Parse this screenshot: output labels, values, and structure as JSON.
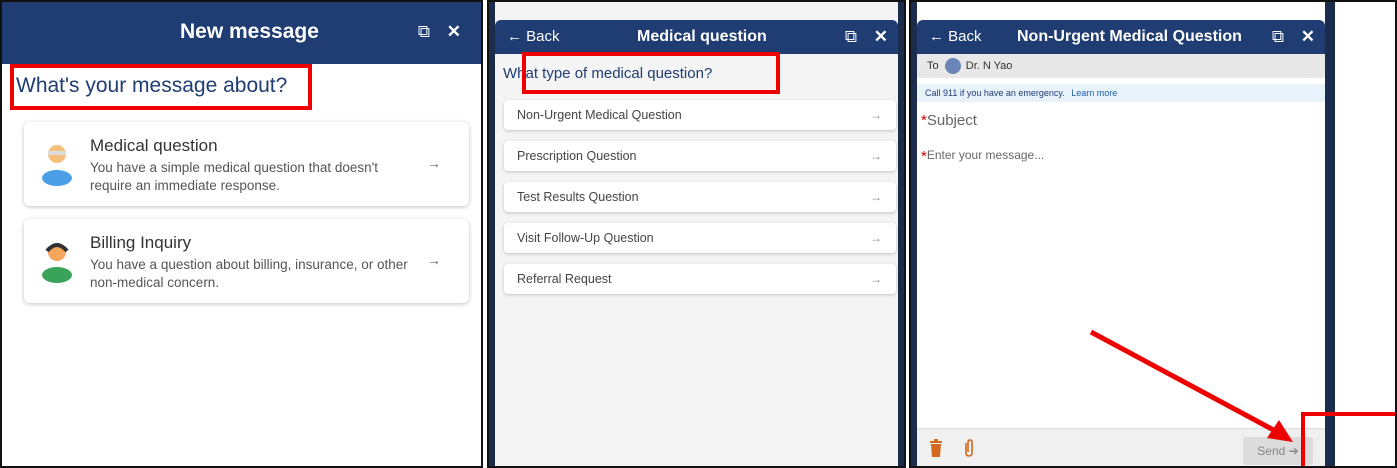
{
  "panel1": {
    "title": "New message",
    "question": "What's your message about?",
    "cards": [
      {
        "title": "Medical question",
        "desc": "You have a simple medical question that doesn't require an immediate response.",
        "arrow": "→"
      },
      {
        "title": "Billing Inquiry",
        "desc": "You have a question about billing, insurance, or other non-medical concern.",
        "arrow": "→"
      }
    ],
    "icons": {
      "popout": "⧉",
      "close": "✕"
    }
  },
  "panel2": {
    "back": "← Back",
    "title": "Medical question",
    "question": "What type of medical question?",
    "items": [
      {
        "label": "Non-Urgent Medical Question",
        "arrow": "→"
      },
      {
        "label": "Prescription Question",
        "arrow": "→"
      },
      {
        "label": "Test Results Question",
        "arrow": "→"
      },
      {
        "label": "Visit Follow-Up Question",
        "arrow": "→"
      },
      {
        "label": "Referral Request",
        "arrow": "→"
      }
    ],
    "icons": {
      "popout": "⧉",
      "close": "✕"
    }
  },
  "panel3": {
    "back": "← Back",
    "title": "Non-Urgent Medical Question",
    "to_label": "To",
    "recipient": "Dr. N Yao",
    "notice": "Call 911 if you have an emergency.",
    "learn_more": "Learn more",
    "subject_placeholder": "Subject",
    "message_placeholder": "Enter your message...",
    "send": "Send",
    "icons": {
      "popout": "⧉",
      "close": "✕",
      "trash": "trash-icon",
      "attach": "paperclip-icon"
    }
  },
  "colors": {
    "header": "#1f3c73",
    "annotation": "#e00000",
    "accent": "#d2691e"
  }
}
